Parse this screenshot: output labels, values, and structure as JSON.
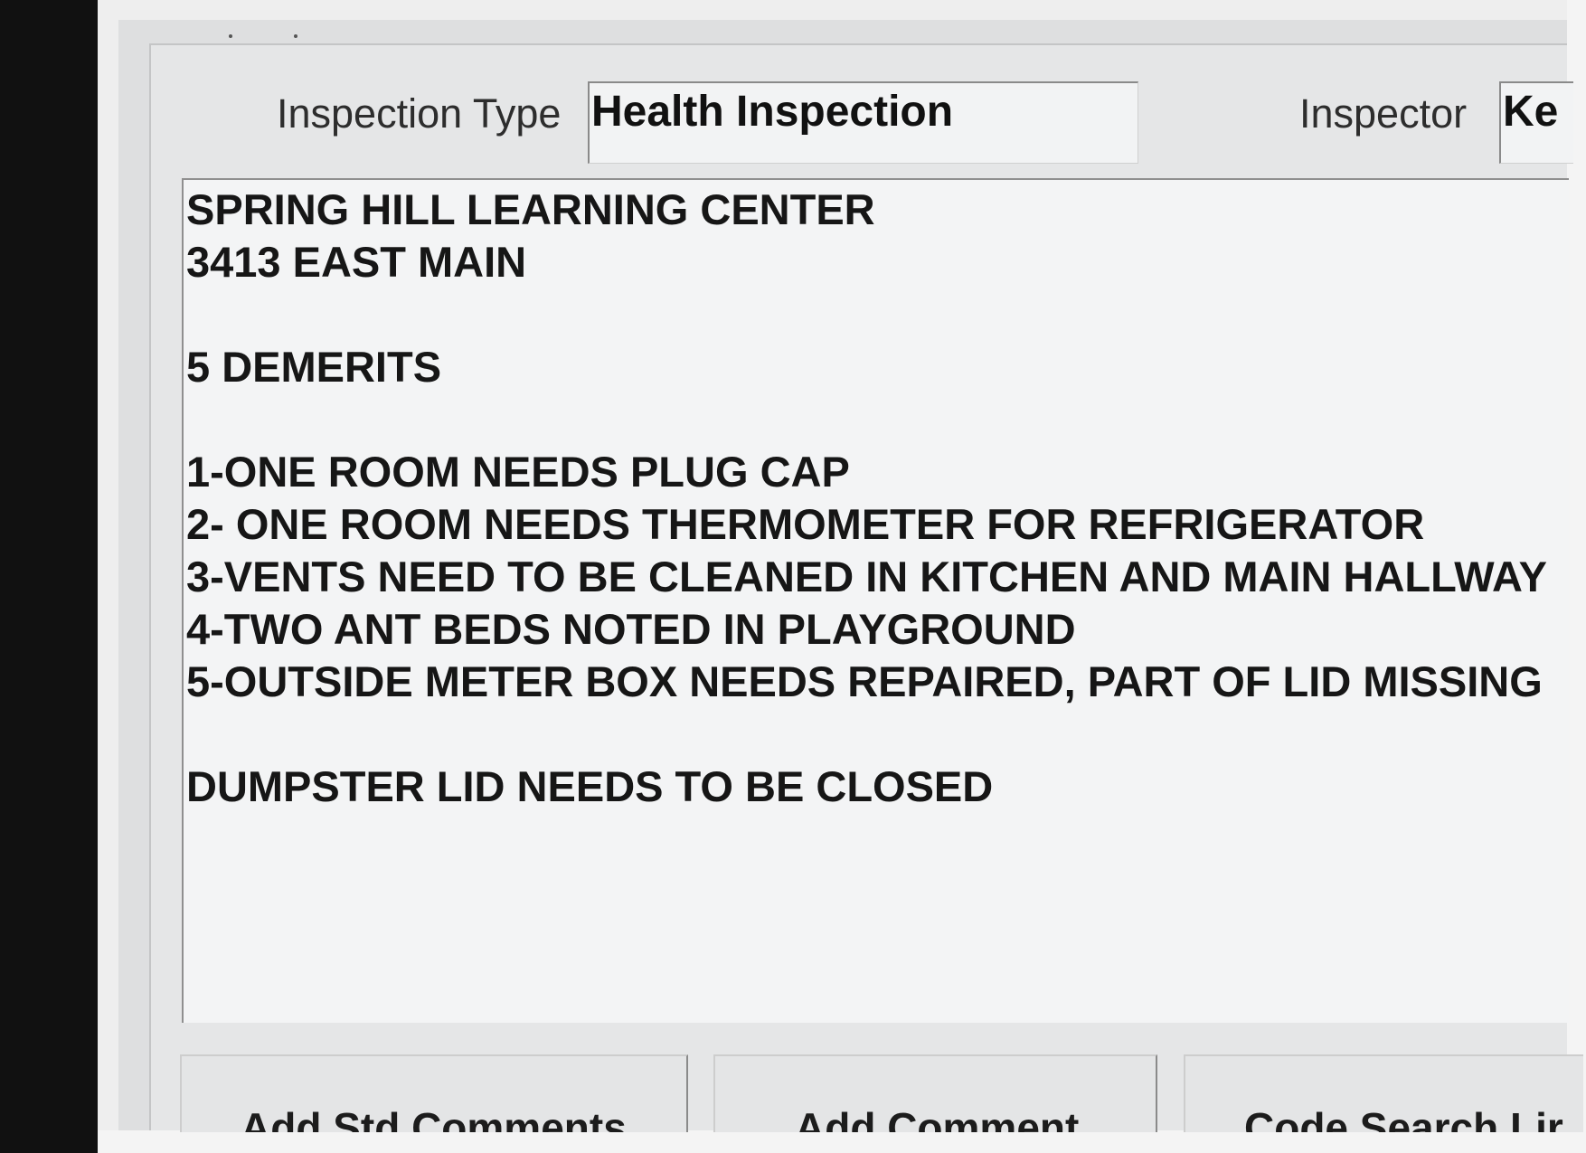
{
  "header": {
    "inspection_type_label": "Inspection Type",
    "inspection_type_value": "Health Inspection",
    "inspector_label": "Inspector",
    "inspector_value": "Ke"
  },
  "comments": {
    "text": "SPRING HILL LEARNING CENTER\n3413 EAST MAIN\n\n5 DEMERITS\n\n1-ONE ROOM NEEDS PLUG CAP\n2- ONE ROOM NEEDS THERMOMETER FOR REFRIGERATOR\n3-VENTS NEED TO BE CLEANED IN KITCHEN AND MAIN HALLWAY\n4-TWO ANT BEDS NOTED IN PLAYGROUND\n5-OUTSIDE METER BOX NEEDS REPAIRED, PART OF LID MISSING\n\nDUMPSTER LID NEEDS TO BE CLOSED"
  },
  "buttons": {
    "add_std_comments": {
      "pre": "Add ",
      "accel": "S",
      "post": "td Comments"
    },
    "add_comment": {
      "pre": "",
      "accel": "A",
      "post": "dd Comment"
    },
    "code_search": {
      "label": "Code Search Lir"
    }
  }
}
